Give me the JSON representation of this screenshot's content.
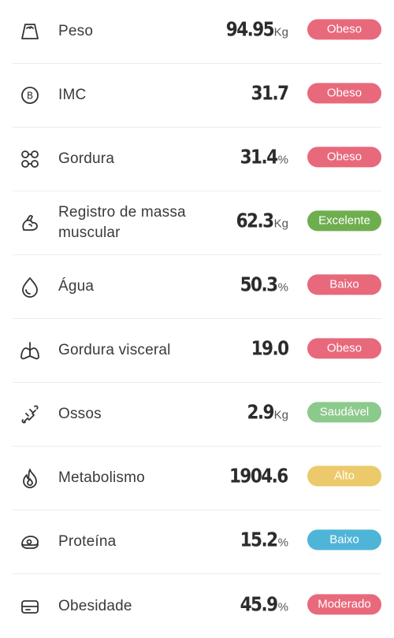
{
  "colors": {
    "obeso": "#e8697b",
    "excelente": "#6fae4e",
    "baixo": "#e8697b",
    "saudavel": "#8cc98c",
    "alto": "#ecc96a",
    "baixo_blue": "#4fb5d8",
    "moderado": "#e8697b"
  },
  "metrics": [
    {
      "icon": "weight-icon",
      "label": "Peso",
      "value": "94.95",
      "unit": "Kg",
      "status": "Obeso",
      "color": "#e8697b"
    },
    {
      "icon": "bmi-icon",
      "label": "IMC",
      "value": "31.7",
      "unit": "",
      "status": "Obeso",
      "color": "#e8697b"
    },
    {
      "icon": "fat-icon",
      "label": "Gordura",
      "value": "31.4",
      "unit": "%",
      "status": "Obeso",
      "color": "#e8697b"
    },
    {
      "icon": "muscle-icon",
      "label": "Registro de massa muscular",
      "value": "62.3",
      "unit": "Kg",
      "status": "Excelente",
      "color": "#6fae4e"
    },
    {
      "icon": "water-drop-icon",
      "label": "Água",
      "value": "50.3",
      "unit": "%",
      "status": "Baixo",
      "color": "#e8697b"
    },
    {
      "icon": "lungs-icon",
      "label": "Gordura visceral",
      "value": "19.0",
      "unit": "",
      "status": "Obeso",
      "color": "#e8697b"
    },
    {
      "icon": "bone-icon",
      "label": "Ossos",
      "value": "2.9",
      "unit": "Kg",
      "status": "Saudável",
      "color": "#8cc98c"
    },
    {
      "icon": "flame-icon",
      "label": "Metabolismo",
      "value": "1904.6",
      "unit": "",
      "status": "Alto",
      "color": "#ecc96a"
    },
    {
      "icon": "protein-icon",
      "label": "Proteína",
      "value": "15.2",
      "unit": "%",
      "status": "Baixo",
      "color": "#4fb5d8"
    },
    {
      "icon": "obesity-icon",
      "label": "Obesidade",
      "value": "45.9",
      "unit": "%",
      "status": "Moderado",
      "color": "#e8697b"
    }
  ]
}
